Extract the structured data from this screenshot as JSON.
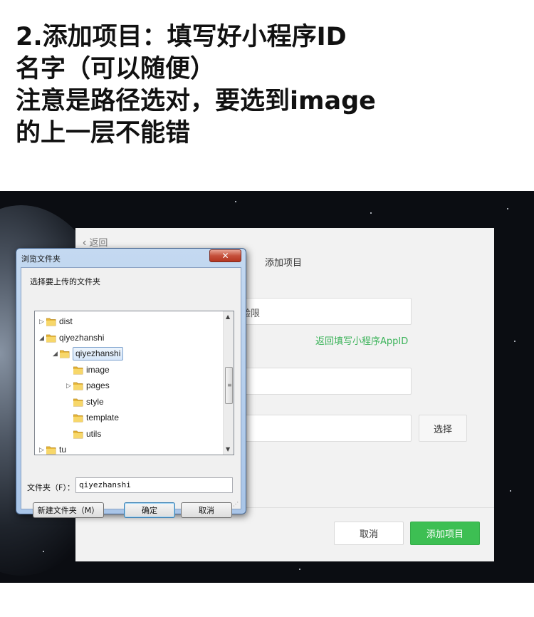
{
  "instructions": {
    "lines": [
      "2.添加项目：填写好小程序ID",
      "名字（可以随便）",
      "注意是路径选对，要选到image",
      "的上一层不能错"
    ]
  },
  "devtools": {
    "back_label": "返回",
    "title": "添加项目",
    "appid_field_text": "验限",
    "appid_link": "返回填写小程序AppID",
    "choose_button": "选择",
    "cancel_button": "取消",
    "add_button": "添加项目",
    "accent_color": "#3dbf53"
  },
  "dialog": {
    "title": "浏览文件夹",
    "close_label": "✕",
    "prompt": "选择要上传的文件夹",
    "tree": [
      {
        "label": "dist",
        "expander": "▷",
        "indent": 0
      },
      {
        "label": "qiyezhanshi",
        "expander": "◢",
        "indent": 0
      },
      {
        "label": "qiyezhanshi",
        "expander": "◢",
        "indent": 1,
        "selected": true
      },
      {
        "label": "image",
        "expander": "",
        "indent": 2
      },
      {
        "label": "pages",
        "expander": "▷",
        "indent": 2
      },
      {
        "label": "style",
        "expander": "",
        "indent": 2
      },
      {
        "label": "template",
        "expander": "",
        "indent": 2
      },
      {
        "label": "utils",
        "expander": "",
        "indent": 2
      },
      {
        "label": "tu",
        "expander": "▷",
        "indent": 0
      }
    ],
    "folder_label": "文件夹（F）：",
    "folder_value": "qiyezhanshi",
    "new_folder_button": "新建文件夹（M）",
    "ok_button": "确定",
    "cancel_button": "取消"
  }
}
